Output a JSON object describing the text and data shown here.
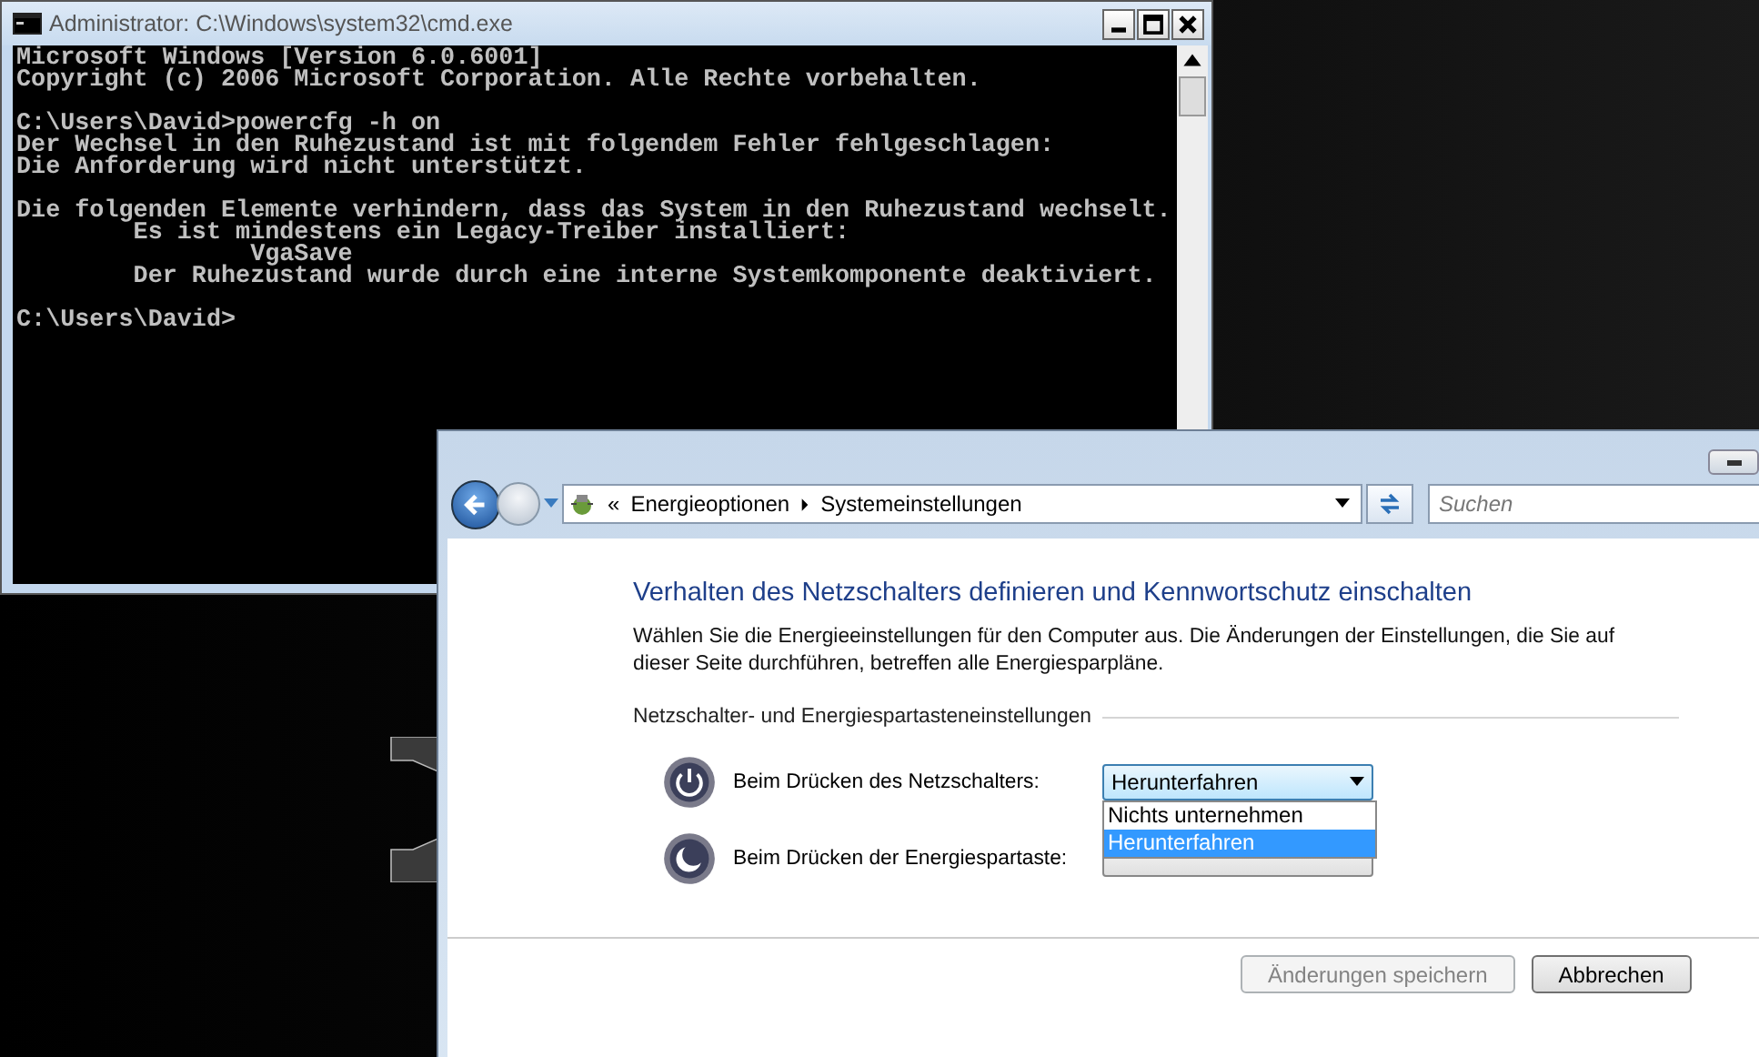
{
  "console_window": {
    "title": "Administrator: C:\\Windows\\system32\\cmd.exe",
    "blocks": [
      [
        "Microsoft Windows [Version 6.0.6001]",
        "Copyright (c) 2006 Microsoft Corporation. Alle Rechte vorbehalten."
      ],
      [
        "C:\\Users\\David>powercfg -h on",
        "Der Wechsel in den Ruhezustand ist mit folgendem Fehler fehlgeschlagen:",
        "Die Anforderung wird nicht unterstützt."
      ],
      [
        "Die folgenden Elemente verhindern, dass das System in den Ruhezustand wechselt.",
        "        Es ist mindestens ein Legacy-Treiber installiert:",
        "                VgaSave",
        "        Der Ruhezustand wurde durch eine interne Systemkomponente deaktiviert."
      ],
      [
        "C:\\Users\\David>"
      ]
    ]
  },
  "settings_window": {
    "breadcrumb_overflow": "«",
    "breadcrumb": [
      "Energieoptionen",
      "Systemeinstellungen"
    ],
    "search": {
      "placeholder": "Suchen"
    },
    "heading": "Verhalten des Netzschalters definieren und Kennwortschutz einschalten",
    "description": "Wählen Sie die Energieeinstellungen für den Computer aus. Die Änderungen der Einstellungen, die Sie auf dieser Seite durchführen, betreffen alle Energiesparpläne.",
    "section_title": "Netzschalter- und Energiespartasteneinstellungen",
    "settings": [
      {
        "kind": "power",
        "label": "Beim Drücken des Netzschalters:",
        "value": "Herunterfahren",
        "expanded": true,
        "options": [
          {
            "label": "Nichts unternehmen",
            "selected": false
          },
          {
            "label": "Herunterfahren",
            "selected": true
          }
        ]
      },
      {
        "kind": "sleep",
        "label": "Beim Drücken der Energiespartaste:",
        "expanded": false
      }
    ],
    "buttons": [
      {
        "label": "Änderungen speichern",
        "disabled": true
      },
      {
        "label": "Abbrechen",
        "disabled": false
      }
    ]
  }
}
